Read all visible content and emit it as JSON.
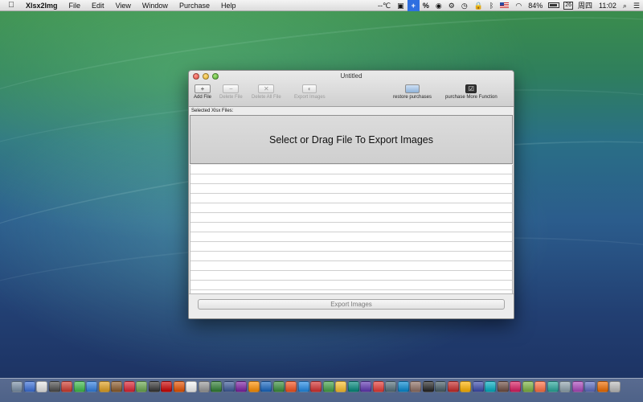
{
  "menubar": {
    "app_name": "Xlsx2Img",
    "items": [
      "File",
      "Edit",
      "View",
      "Window",
      "Purchase",
      "Help"
    ],
    "status": {
      "temperature": "--℃",
      "plus_label": "+",
      "percent_label": "%",
      "battery": "84%",
      "calendar_day": "26",
      "weekday": "周四",
      "time": "11:02"
    }
  },
  "window": {
    "title": "Untitled",
    "toolbar": {
      "add_file": "Add File",
      "delete_file": "Delete File",
      "delete_all_file": "Delete All File",
      "export_images": "Export Images",
      "restore_purchases": "restore purchases",
      "purchase_more": "purchase More Function"
    },
    "selected_label": "Selected Xlsx Files:",
    "drop_zone_text": "Select or Drag File To Export Images",
    "export_button": "Export Images"
  },
  "dock": {
    "icon_colors": [
      "#7a8fa6",
      "#3a6fd8",
      "#e7e7e7",
      "#4a4a4a",
      "#cf3b2f",
      "#3dbb4a",
      "#2f7de0",
      "#e0a020",
      "#8b5a2b",
      "#d23",
      "#6aa84f",
      "#333",
      "#c00",
      "#e65100",
      "#f5f5f5",
      "#999",
      "#2e7d32",
      "#3b5998",
      "#7b1fa2",
      "#ff8f00",
      "#1565c0",
      "#388e3c",
      "#f4511e",
      "#1e88e5",
      "#d32f2f",
      "#43a047",
      "#fbc02d",
      "#00897b",
      "#5e35b1",
      "#e53935",
      "#546e7a",
      "#0288d1",
      "#8d6e63",
      "#222",
      "#455a64",
      "#c62828",
      "#ffb300",
      "#3949ab",
      "#00acc1",
      "#6d4c41",
      "#d81b60",
      "#7cb342",
      "#ff7043",
      "#26a69a",
      "#90a4ae",
      "#ab47bc",
      "#5c6bc0",
      "#ef6c00",
      "#bdbdbd"
    ]
  }
}
